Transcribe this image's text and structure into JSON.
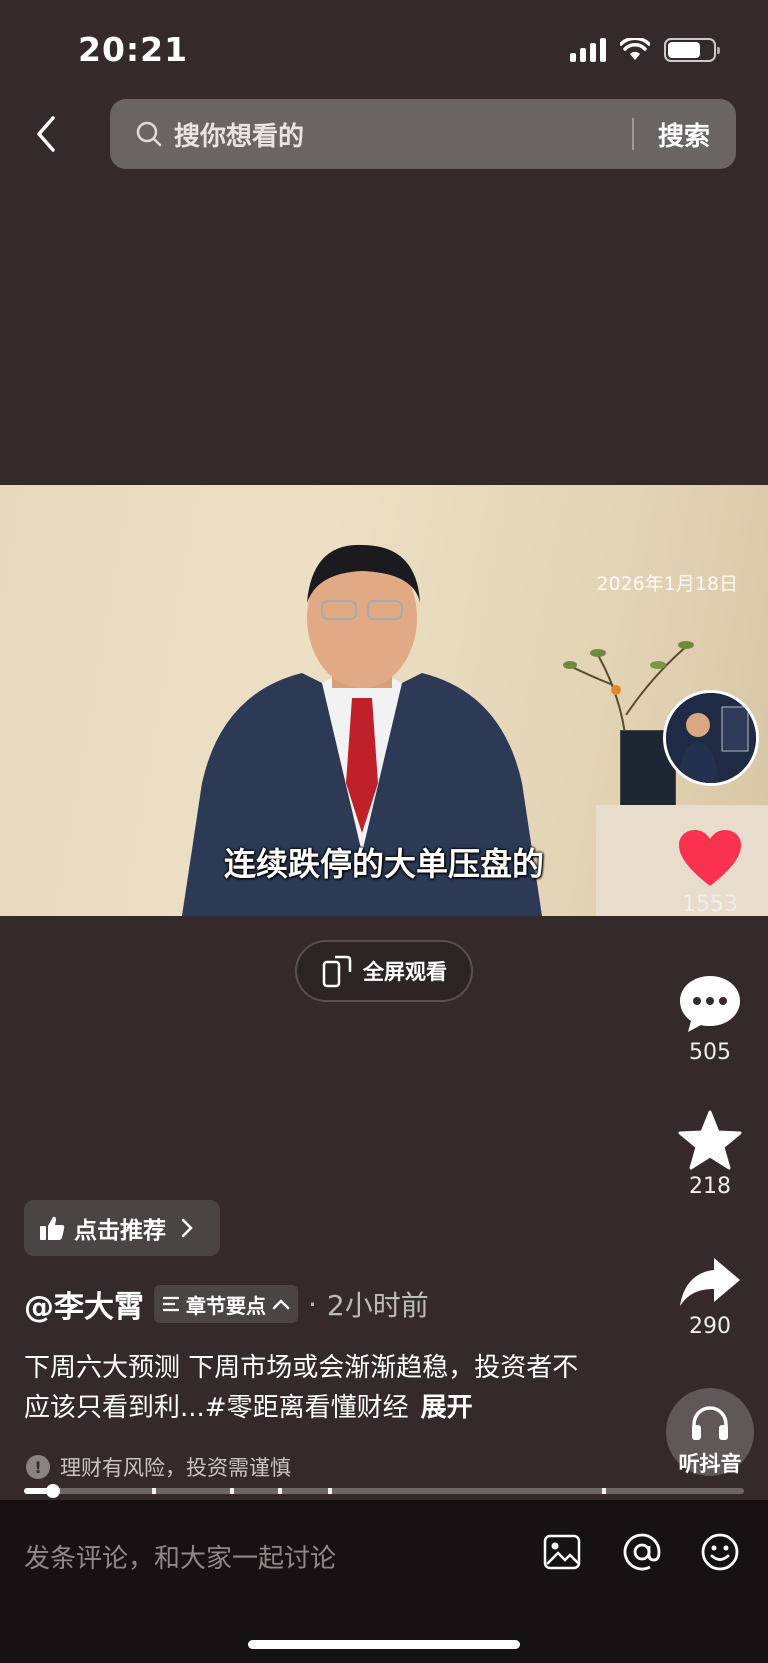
{
  "status_bar": {
    "time": "20:21"
  },
  "search": {
    "placeholder": "搜你想看的",
    "button": "搜索"
  },
  "video": {
    "date_overlay": "2026年1月18日",
    "subtitle": "连续跌停的大单压盘的"
  },
  "fullscreen_label": "全屏观看",
  "actions": {
    "like_count": "1553",
    "comment_count": "505",
    "favorite_count": "218",
    "share_count": "290",
    "listen_label": "听抖音"
  },
  "recommend_label": "点击推荐",
  "author": {
    "name": "@李大霄",
    "chapter_label": "章节要点",
    "time_ago": "2小时前",
    "separator": "·"
  },
  "description": {
    "text": "下周六大预测 下周市场或会渐渐趋稳，投资者不应该只看到利...#零距离看懂财经",
    "expand": "展开"
  },
  "risk_notice": "理财有风险，投资需谨慎",
  "progress": {
    "played_fraction": 0.04
  },
  "comment_placeholder": "发条评论，和大家一起讨论",
  "colors": {
    "background": "#342a2b",
    "like_red": "#f8324f",
    "bottom_bar": "#161213"
  }
}
